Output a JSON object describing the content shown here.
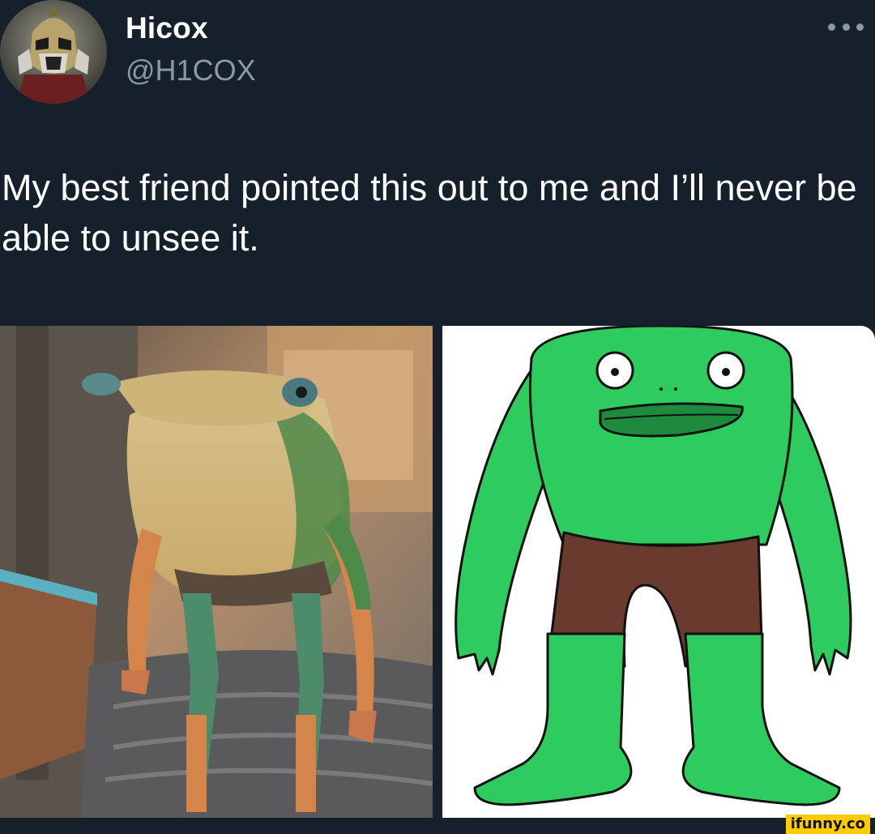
{
  "tweet": {
    "author": {
      "display_name": "Hicox",
      "handle": "@H1COX",
      "avatar_icon": "masked-helmet-avatar"
    },
    "more_icon": "more-options-icon",
    "text": "My best friend pointed this out to me and I’ll never be able to unsee it.",
    "media": [
      {
        "icon": "live-action-frog-creature-photo"
      },
      {
        "icon": "cartoon-green-frog-drawing"
      }
    ]
  },
  "watermark": {
    "text": "ifunny.co",
    "color": "#ffcc00"
  },
  "colors": {
    "background": "#15202b",
    "text_primary": "#ffffff",
    "text_secondary": "#8b98a5",
    "cartoon_green": "#2ecc5e",
    "cartoon_shorts": "#6b3a2e"
  }
}
